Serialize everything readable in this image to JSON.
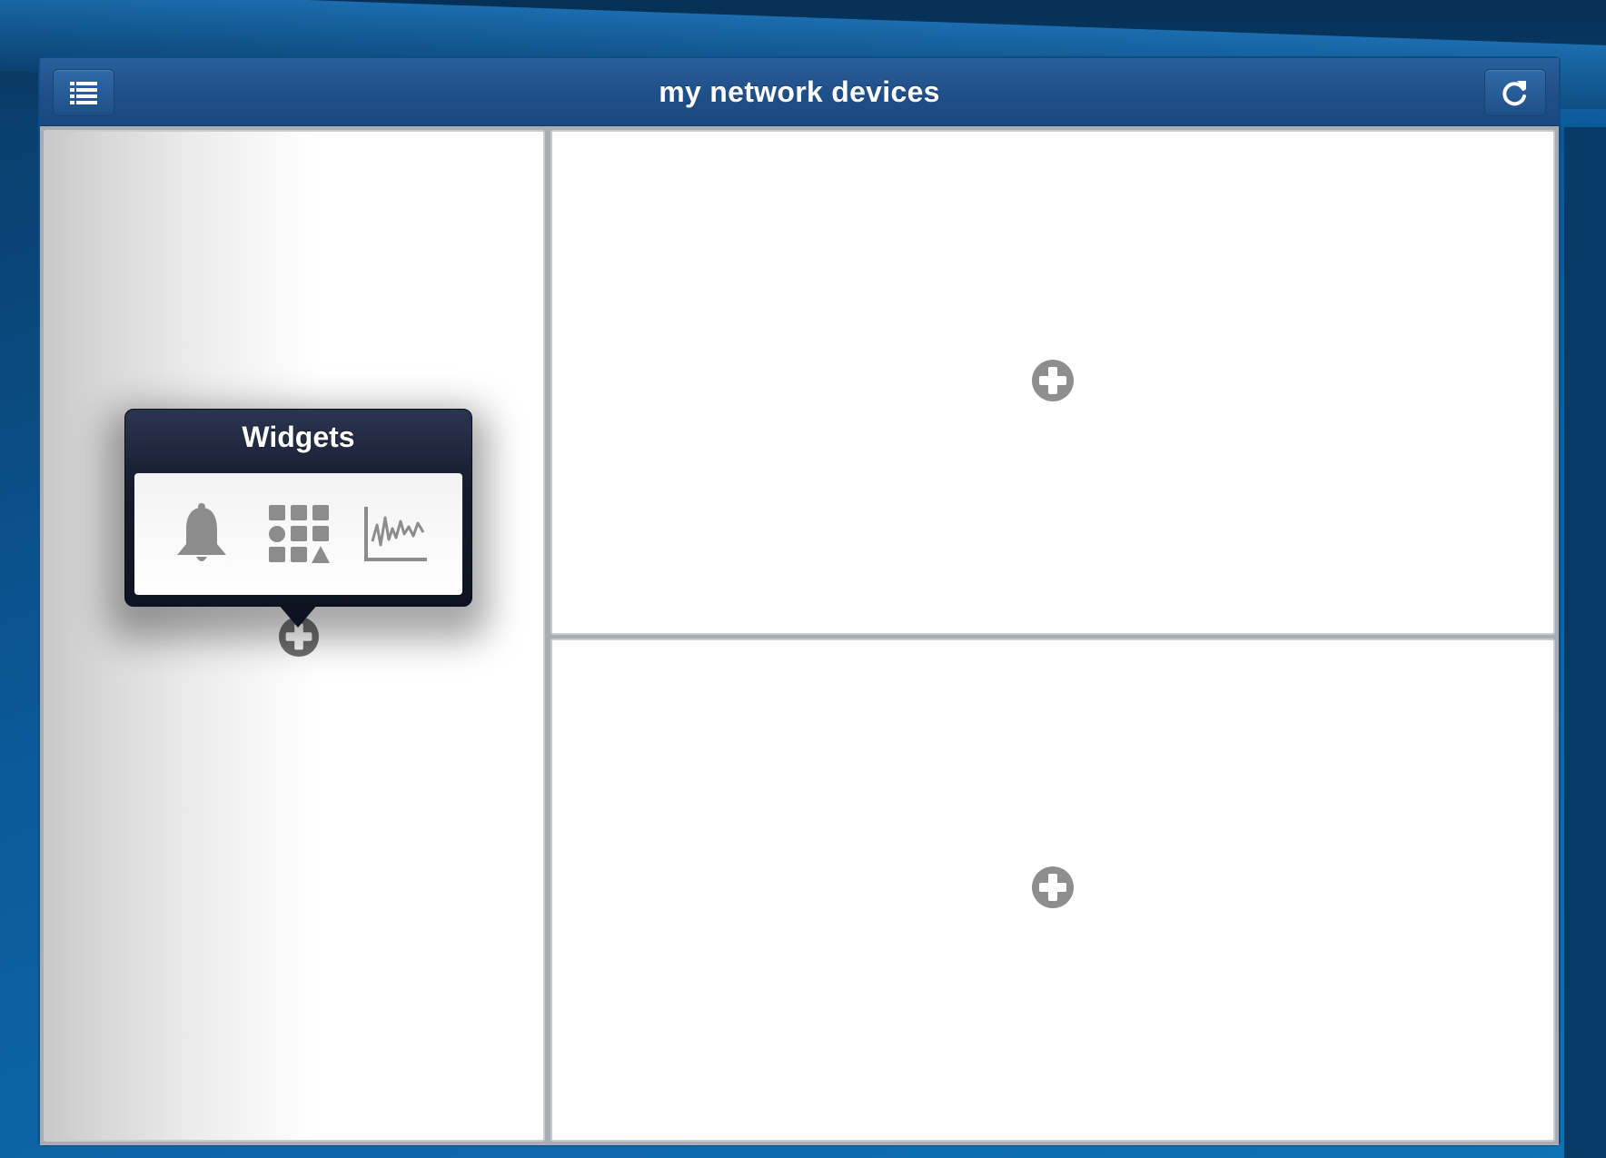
{
  "app": {
    "title": "my network devices"
  },
  "navbar": {
    "menu_icon": "list-icon",
    "refresh_icon": "refresh-icon"
  },
  "popover": {
    "title": "Widgets",
    "options": [
      {
        "icon": "bell-icon"
      },
      {
        "icon": "grid-icon"
      },
      {
        "icon": "chart-icon"
      }
    ]
  },
  "panels": [
    {
      "name": "left",
      "action_icon": "add-circle-icon"
    },
    {
      "name": "top-right",
      "action_icon": "add-circle-icon"
    },
    {
      "name": "bottom-right",
      "action_icon": "add-circle-icon"
    }
  ],
  "colors": {
    "navbar": "#1f4f88",
    "background": "#0b5a9a",
    "popover": "#151c2e",
    "icon_gray": "#8c8c8c"
  }
}
